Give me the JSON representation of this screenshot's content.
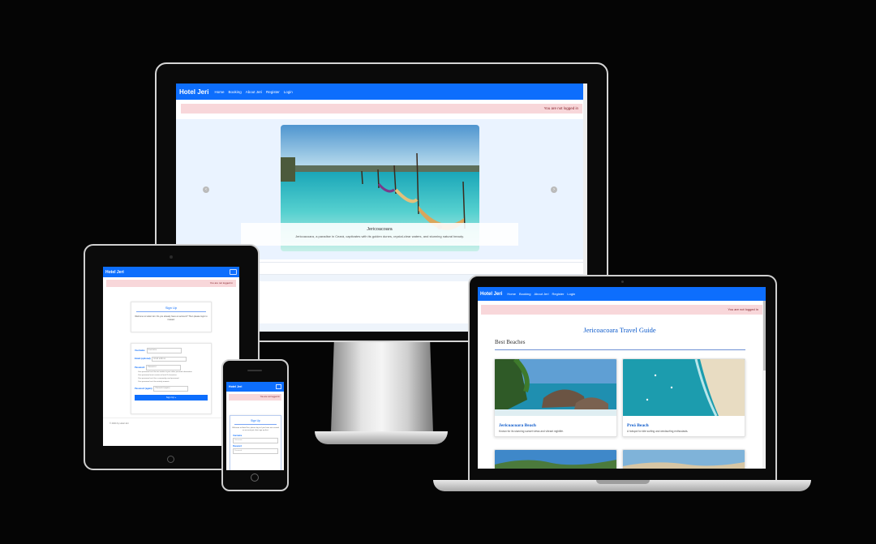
{
  "brand": "Hotel Jeri",
  "nav": [
    "Home",
    "Booking",
    "About Jeri",
    "Register",
    "Login"
  ],
  "alert": "You are not logged in",
  "carousel": {
    "caption_title": "Jericoacoara",
    "caption_text": "Jericoacoara, a paradise in Ceará, captivates with its golden dunes, crystal-clear waters, and stunning natural beauty.",
    "prev": "‹",
    "next": "›"
  },
  "signup": {
    "title": "Sign Up",
    "intro": "Welcome to Hotel Jeri. Do you already have an account? Then please login to instead.",
    "username_label": "Username",
    "username_placeholder": "Username",
    "email_label": "Email (optional)",
    "email_placeholder": "Email address",
    "password_label": "Password",
    "password_placeholder": "Password",
    "password_help": [
      "Your password can’t be too similar to your other personal information.",
      "Your password must contain at least 8 characters.",
      "Your password can’t be a commonly used password.",
      "Your password can’t be entirely numeric."
    ],
    "password2_label": "Password (again)",
    "password2_placeholder": "Password (again)",
    "button": "Sign Up »"
  },
  "phone_signup": {
    "intro": "Welcome to Hotel Jeri, please log in if you have not created an account yet, then sign up first."
  },
  "footer": "© 2024 by Hotel Jeri",
  "guide": {
    "title": "Jericoacoara Travel Guide",
    "section": "Best Beaches",
    "beaches": [
      {
        "name": "Jericoacoara Beach",
        "desc": "Known for its stunning sunset views and vibrant nightlife."
      },
      {
        "name": "Preá Beach",
        "desc": "A hotspot for kite surfing and windsurfing enthusiasts."
      }
    ]
  },
  "colors": {
    "primary": "#0d6efd",
    "alert_bg": "#f8d7da",
    "alert_text": "#842029",
    "background": "#050505"
  }
}
